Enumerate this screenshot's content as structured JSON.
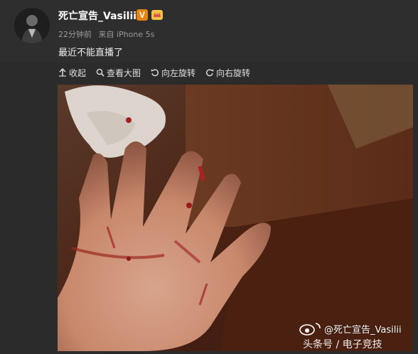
{
  "post": {
    "username": "死亡宣告_Vasilii",
    "verified_badge": "V",
    "verified_color": "#e8830e",
    "vip_icon": "crown-icon",
    "time": "22分钟前",
    "source": "来自 iPhone 5s",
    "text": "最近不能直播了"
  },
  "toolbar": {
    "collapse": "收起",
    "view_large": "查看大图",
    "rotate_left": "向左旋转",
    "rotate_right": "向右旋转"
  },
  "photo": {
    "watermark_handle": "@死亡宣告_Vasilii",
    "watermark_site": "头条号 / 电子竞技"
  }
}
